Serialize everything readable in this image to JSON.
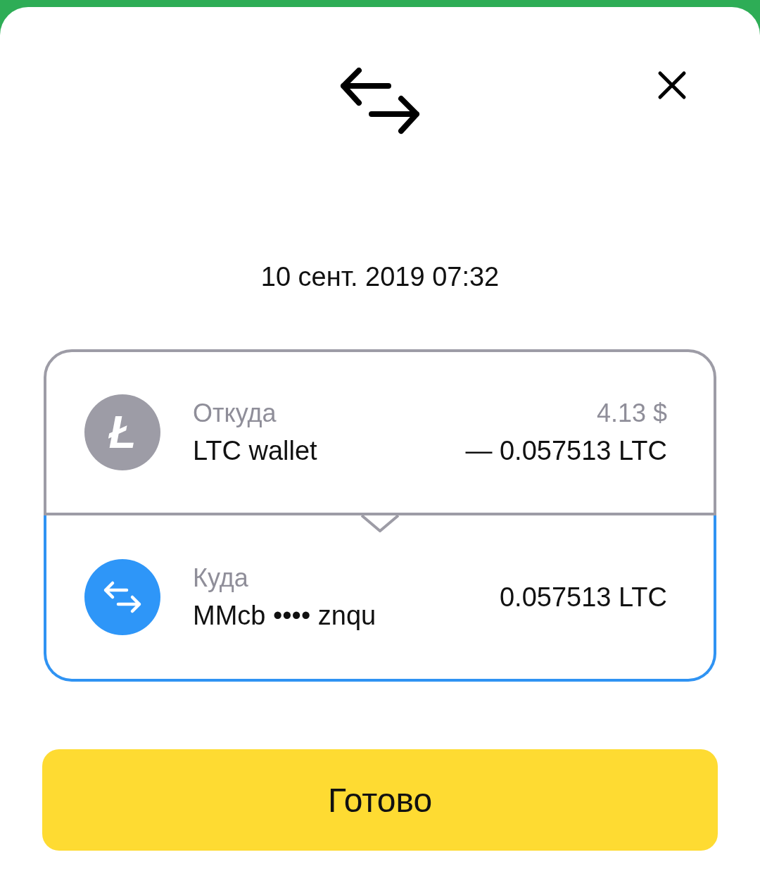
{
  "date": "10 сент. 2019 07:32",
  "sections": [
    {
      "kind": "litecoin",
      "icon_glyph": "Ł",
      "label": "Откуда",
      "name": "LTC wallet",
      "fiat": "4.13 $",
      "amount": "— 0.057513 LTC"
    },
    {
      "kind": "transfer",
      "label": "Куда",
      "name": "MMcb •••• znqu",
      "amount": "0.057513 LTC"
    }
  ],
  "button": "Готово"
}
